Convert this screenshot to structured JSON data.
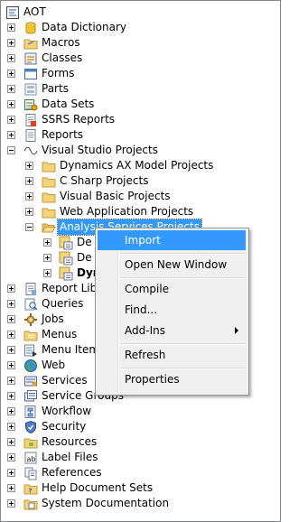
{
  "tree": {
    "root": "AOT",
    "nodes": [
      {
        "label": "Data Dictionary",
        "icon": "data-dictionary-icon"
      },
      {
        "label": "Macros",
        "icon": "macros-icon"
      },
      {
        "label": "Classes",
        "icon": "classes-icon"
      },
      {
        "label": "Forms",
        "icon": "forms-icon"
      },
      {
        "label": "Parts",
        "icon": "parts-icon"
      },
      {
        "label": "Data Sets",
        "icon": "data-sets-icon"
      },
      {
        "label": "SSRS Reports",
        "icon": "ssrs-reports-icon"
      },
      {
        "label": "Reports",
        "icon": "reports-icon"
      },
      {
        "label": "Visual Studio Projects",
        "icon": "visual-studio-projects-icon"
      },
      {
        "label": "Dynamics AX Model Projects",
        "icon": "folder-icon"
      },
      {
        "label": "C Sharp Projects",
        "icon": "folder-icon"
      },
      {
        "label": "Visual Basic Projects",
        "icon": "folder-icon"
      },
      {
        "label": "Web Application Projects",
        "icon": "folder-icon"
      },
      {
        "label": "Analysis Services Projects",
        "icon": "folder-open-icon"
      },
      {
        "label": "De",
        "icon": "project-icon"
      },
      {
        "label": "De",
        "icon": "project-icon"
      },
      {
        "label": "Dyn",
        "icon": "project-icon"
      },
      {
        "label": "Report Libr",
        "icon": "report-libraries-icon"
      },
      {
        "label": "Queries",
        "icon": "queries-icon"
      },
      {
        "label": "Jobs",
        "icon": "jobs-icon"
      },
      {
        "label": "Menus",
        "icon": "menus-icon"
      },
      {
        "label": "Menu Item",
        "icon": "menu-items-icon"
      },
      {
        "label": "Web",
        "icon": "web-icon"
      },
      {
        "label": "Services",
        "icon": "services-icon"
      },
      {
        "label": "Service Groups",
        "icon": "service-groups-icon"
      },
      {
        "label": "Workflow",
        "icon": "workflow-icon"
      },
      {
        "label": "Security",
        "icon": "security-icon"
      },
      {
        "label": "Resources",
        "icon": "resources-icon"
      },
      {
        "label": "Label Files",
        "icon": "label-files-icon"
      },
      {
        "label": "References",
        "icon": "references-icon"
      },
      {
        "label": "Help Document Sets",
        "icon": "help-document-sets-icon"
      },
      {
        "label": "System Documentation",
        "icon": "system-documentation-icon"
      }
    ]
  },
  "context_menu": {
    "items": [
      {
        "label": "Import"
      },
      {
        "label": "Open New Window"
      },
      {
        "label": "Compile"
      },
      {
        "label": "Find..."
      },
      {
        "label": "Add-Ins"
      },
      {
        "label": "Refresh"
      },
      {
        "label": "Properties"
      }
    ]
  },
  "colors": {
    "selection": "#3399ff",
    "menu_bg": "#f0f0f0",
    "border": "#828790"
  }
}
